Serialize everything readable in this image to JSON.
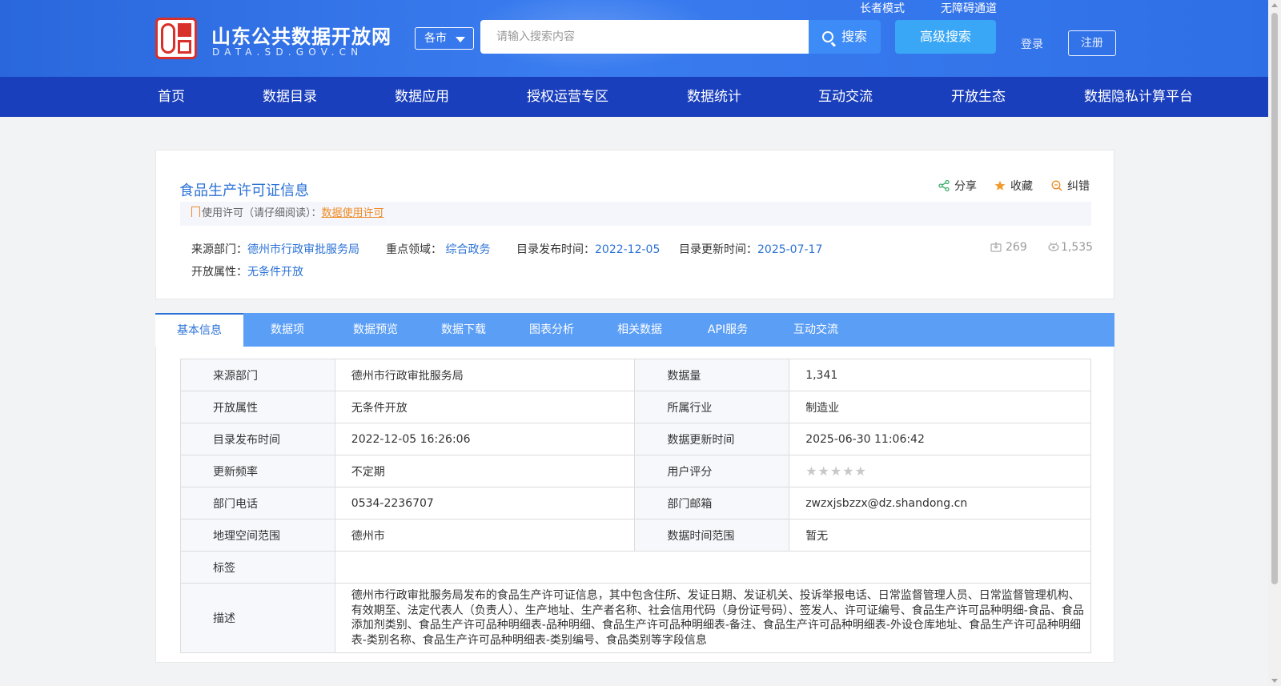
{
  "site": {
    "name": "山东公共数据开放网",
    "domain_text": "DATA.SD.GOV.CN",
    "seal_icon": "seal-logo-icon"
  },
  "header": {
    "region_label": "各市",
    "search_placeholder": "请输入搜索内容",
    "search_button": "搜索",
    "advanced_search": "高级搜索",
    "elder_mode": "长者模式",
    "accessibility": "无障碍通道",
    "login": "登录",
    "register": "注册"
  },
  "nav": [
    "首页",
    "数据目录",
    "数据应用",
    "授权运营专区",
    "数据统计",
    "互动交流",
    "开放生态",
    "数据隐私计算平台"
  ],
  "dataset": {
    "title": "食品生产许可证信息",
    "actions": {
      "share": "分享",
      "favorite": "收藏",
      "report": "纠错"
    },
    "license_prefix": "使用许可（请仔细阅读）：",
    "license_link": "数据使用许可",
    "meta": {
      "source_label": "来源部门：",
      "source_value": "德州市行政审批服务局",
      "domain_label": "重点领域：",
      "domain_value": "综合政务",
      "publish_label": "目录发布时间：",
      "publish_value": "2022-12-05",
      "update_label": "目录更新时间：",
      "update_value": "2025-07-17",
      "open_label": "开放属性：",
      "open_value": "无条件开放"
    },
    "downloads": "269",
    "views": "1,535"
  },
  "tabs": [
    "基本信息",
    "数据项",
    "数据预览",
    "数据下载",
    "图表分析",
    "相关数据",
    "API服务",
    "互动交流"
  ],
  "info_table": {
    "rows": [
      {
        "l1": "来源部门",
        "v1": "德州市行政审批服务局",
        "l2": "数据量",
        "v2": "1,341"
      },
      {
        "l1": "开放属性",
        "v1": "无条件开放",
        "l2": "所属行业",
        "v2": "制造业"
      },
      {
        "l1": "目录发布时间",
        "v1": "2022-12-05 16:26:06",
        "l2": "数据更新时间",
        "v2": "2025-06-30 11:06:42"
      },
      {
        "l1": "更新频率",
        "v1": "不定期",
        "l2": "用户评分",
        "v2": ""
      },
      {
        "l1": "部门电话",
        "v1": "0534-2236707",
        "l2": "部门邮箱",
        "v2": "zwzxjsbzzx@dz.shandong.cn"
      },
      {
        "l1": "地理空间范围",
        "v1": "德州市",
        "l2": "数据时间范围",
        "v2": "暂无"
      }
    ],
    "rating_stars": 0,
    "tags_label": "标签",
    "tags_value": "",
    "desc_label": "描述",
    "desc_value": "德州市行政审批服务局发布的食品生产许可证信息，其中包含住所、发证日期、发证机关、投诉举报电话、日常监督管理人员、日常监督管理机构、有效期至、法定代表人（负责人）、生产地址、生产者名称、社会信用代码（身份证号码）、签发人、许可证编号、食品生产许可品种明细-食品、食品添加剂类别、食品生产许可品种明细表-品种明细、食品生产许可品种明细表-备注、食品生产许可品种明细表-外设仓库地址、食品生产许可品种明细表-类别名称、食品生产许可品种明细表-类别编号、食品类别等字段信息"
  },
  "colors": {
    "header_blue": "#2f6fe6",
    "nav_blue": "#1a3fbd",
    "tab_blue": "#5b9ef6",
    "link_blue": "#2b72d6",
    "license_orange": "#f08a24"
  }
}
